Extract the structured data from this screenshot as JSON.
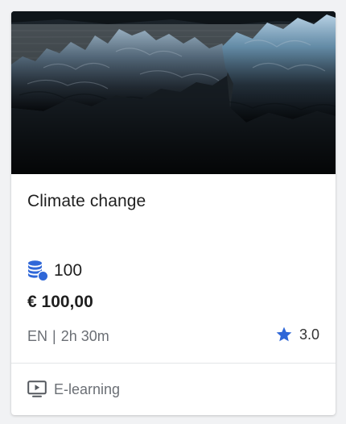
{
  "card": {
    "image_icon": "glacier-ice-photo",
    "title": "Climate change",
    "credits": {
      "icon": "coin-stack-icon",
      "value": "100"
    },
    "price": "€ 100,00",
    "language": "EN",
    "separator": "|",
    "duration": "2h 30m",
    "rating": {
      "icon": "star-icon",
      "value": "3.0"
    },
    "format": {
      "icon": "monitor-play-icon",
      "label": "E-learning"
    }
  },
  "colors": {
    "accent_blue": "#2f67d8",
    "text_primary": "#1f1f1f",
    "text_secondary": "#6b6f75",
    "divider": "#e3e5e8"
  }
}
